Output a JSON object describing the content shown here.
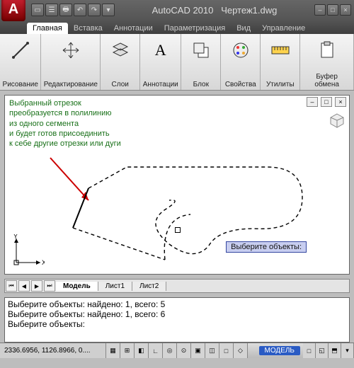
{
  "app": {
    "title": "AutoCAD 2010",
    "document": "Чертеж1.dwg",
    "logo_letter": "A"
  },
  "qat": [
    "▭",
    "☰",
    "🖶",
    "↶",
    "↷",
    "▾"
  ],
  "window_controls": [
    "–",
    "□",
    "×"
  ],
  "tabs": [
    "Главная",
    "Вставка",
    "Аннотации",
    "Параметризация",
    "Вид",
    "Управление"
  ],
  "active_tab": 0,
  "ribbon_panels": [
    {
      "id": "draw",
      "label": "Рисование",
      "icon": "line-icon"
    },
    {
      "id": "modify",
      "label": "Редактирование",
      "icon": "move-icon"
    },
    {
      "id": "layers",
      "label": "Слои",
      "icon": "layers-icon"
    },
    {
      "id": "anno",
      "label": "Аннотации",
      "icon": "text-a-icon"
    },
    {
      "id": "block",
      "label": "Блок",
      "icon": "block-icon"
    },
    {
      "id": "props",
      "label": "Свойства",
      "icon": "palette-icon"
    },
    {
      "id": "utils",
      "label": "Утилиты",
      "icon": "ruler-icon"
    },
    {
      "id": "clip",
      "label": "Буфер обмена",
      "icon": "clipboard-icon"
    }
  ],
  "canvas": {
    "annotation_lines": [
      "Выбранный отрезок",
      "преобразуется в полилинию",
      "из одного сегмента",
      "и будет готов присоединить",
      "к себе другие отрезки или дуги"
    ],
    "prompt": "Выберите объекты:",
    "axes": {
      "x": "X",
      "y": "Y"
    }
  },
  "sheet_tabs": [
    "Модель",
    "Лист1",
    "Лист2"
  ],
  "active_sheet": 0,
  "command_log": [
    "Выберите объекты: найдено: 1, всего: 5",
    "Выберите объекты: найдено: 1, всего: 6",
    "",
    "Выберите объекты:"
  ],
  "status": {
    "coords": "2336.6956, 1126.8966, 0....",
    "toggles": [
      "▦",
      "⊞",
      "◧",
      "∟",
      "◎",
      "⊙",
      "▣",
      "◫",
      "□",
      "◇"
    ],
    "space_label": "МОДЕЛЬ",
    "right_icons": [
      "□",
      "◱",
      "⬒",
      "▾"
    ]
  }
}
